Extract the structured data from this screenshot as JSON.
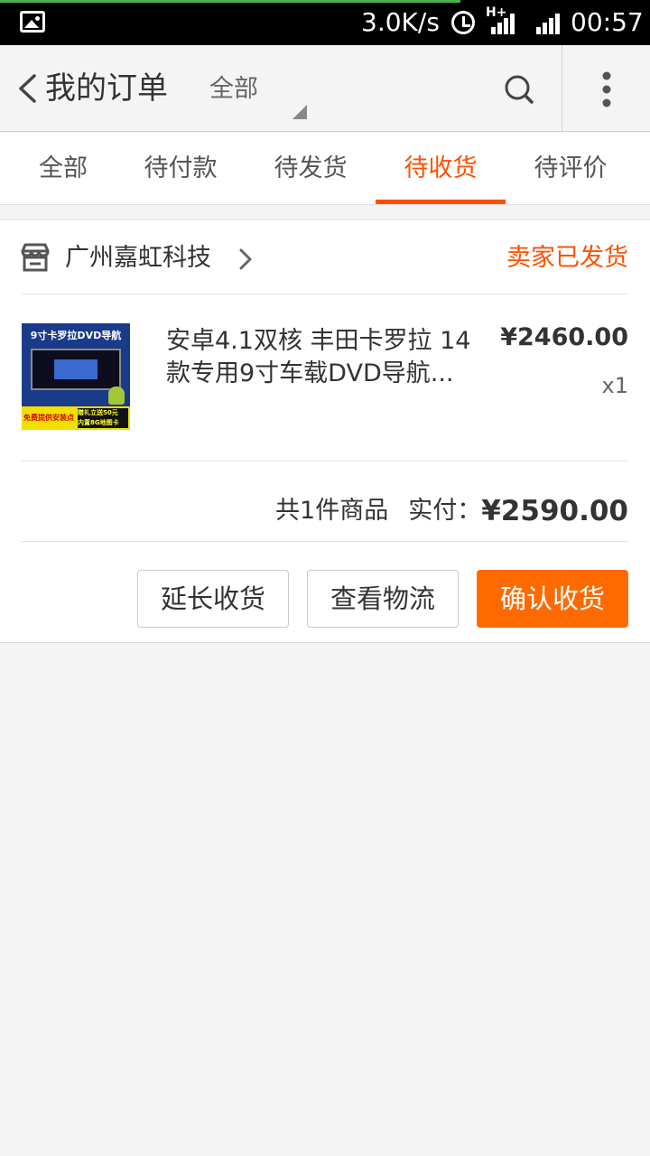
{
  "status_bar": {
    "net_speed": "3.0K/s",
    "network_type": "H+",
    "time": "00:57"
  },
  "header": {
    "title": "我的订单",
    "filter_label": "全部",
    "icons": {
      "back": "chevron-left-icon",
      "search": "search-icon",
      "more": "more-vertical-icon"
    }
  },
  "tabs": [
    {
      "label": "全部",
      "active": false
    },
    {
      "label": "待付款",
      "active": false
    },
    {
      "label": "待发货",
      "active": false
    },
    {
      "label": "待收货",
      "active": true
    },
    {
      "label": "待评价",
      "active": false
    }
  ],
  "order": {
    "store_name": "广州嘉虹科技",
    "status": "卖家已发货",
    "product": {
      "name_line1": "安卓4.1双核 丰田卡罗拉 14",
      "name_line2": "款专用9寸车载DVD导航...",
      "price": "¥2460.00",
      "quantity": "x1",
      "thumb_title": "9寸卡罗拉DVD导航",
      "thumb_promo_left": "免费提供安装点",
      "thumb_promo_right_1": "赠礼立送50元",
      "thumb_promo_right_2": "内置8G地图卡"
    },
    "summary": {
      "count_text": "共1件商品",
      "paid_label": "实付：",
      "paid_amount": "¥2590.00"
    },
    "buttons": {
      "extend": "延长收货",
      "logistics": "查看物流",
      "confirm": "确认收货"
    }
  },
  "colors": {
    "accent": "#ff5000",
    "primary_button": "#ff6a00"
  }
}
